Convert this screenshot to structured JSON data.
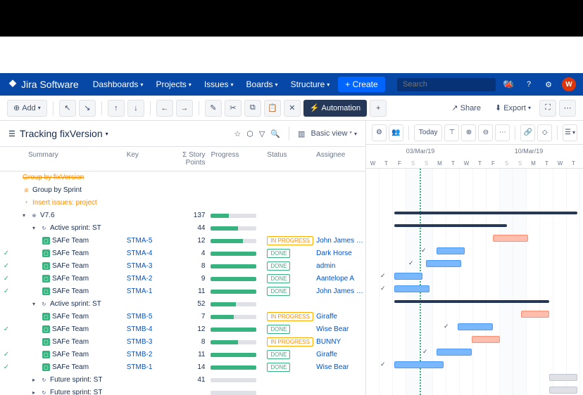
{
  "nav": {
    "product": "Jira Software",
    "items": [
      "Dashboards",
      "Projects",
      "Issues",
      "Boards",
      "Structure"
    ],
    "create": "+ Create",
    "search_placeholder": "Search",
    "avatar_letter": "W"
  },
  "toolbar": {
    "add": "Add",
    "automation": "Automation",
    "share": "Share",
    "export": "Export"
  },
  "structure": {
    "title": "Tracking fixVersion",
    "basic_view": "Basic view"
  },
  "columns": {
    "summary": "Summary",
    "key": "Key",
    "sp": "Σ Story Points",
    "progress": "Progress",
    "status": "Status",
    "assignee": "Assignee"
  },
  "rows": [
    {
      "indent": 1,
      "type": "group",
      "summary": "Group by fixVersion",
      "strike": true,
      "expand": "",
      "check": false
    },
    {
      "indent": 1,
      "type": "group",
      "summary": "Group by Sprint",
      "icon": "⊞",
      "iconColor": "#ff8b00",
      "expand": "",
      "check": false
    },
    {
      "indent": 1,
      "type": "add",
      "summary": "Insert issues: project",
      "icon": "+",
      "iconColor": "#ff8b00",
      "expand": "",
      "check": false
    },
    {
      "indent": 1,
      "type": "version",
      "summary": "V7.6",
      "expand": "v",
      "sp": "137",
      "prog": [
        40,
        60
      ],
      "check": false,
      "icon": "⊕"
    },
    {
      "indent": 2,
      "type": "sprint",
      "summary": "Active sprint: ST",
      "expand": "v",
      "sp": "44",
      "prog": [
        60,
        40
      ],
      "check": false,
      "icon": "↻"
    },
    {
      "indent": 3,
      "type": "story",
      "summary": "SAFe Team",
      "key": "STMA-5",
      "sp": "12",
      "prog": [
        70,
        30
      ],
      "status": "IN PROGRESS",
      "assignee": "John James O'D",
      "check": false
    },
    {
      "indent": 3,
      "type": "story",
      "summary": "SAFe Team",
      "key": "STMA-4",
      "sp": "4",
      "prog": [
        100,
        0
      ],
      "status": "DONE",
      "assignee": "Dark Horse",
      "check": true
    },
    {
      "indent": 3,
      "type": "story",
      "summary": "SAFe Team",
      "key": "STMA-3",
      "sp": "8",
      "prog": [
        100,
        0
      ],
      "status": "DONE",
      "assignee": "admin",
      "check": true
    },
    {
      "indent": 3,
      "type": "story",
      "summary": "SAFe Team",
      "key": "STMA-2",
      "sp": "9",
      "prog": [
        100,
        0
      ],
      "status": "DONE",
      "assignee": "Aantelope A",
      "check": true
    },
    {
      "indent": 3,
      "type": "story",
      "summary": "SAFe Team",
      "key": "STMA-1",
      "sp": "11",
      "prog": [
        100,
        0
      ],
      "status": "DONE",
      "assignee": "John James O'D",
      "check": true
    },
    {
      "indent": 2,
      "type": "sprint",
      "summary": "Active sprint: ST",
      "expand": "v",
      "sp": "52",
      "prog": [
        55,
        45
      ],
      "check": false,
      "icon": "↻"
    },
    {
      "indent": 3,
      "type": "story",
      "summary": "SAFe Team",
      "key": "STMB-5",
      "sp": "7",
      "prog": [
        50,
        50
      ],
      "status": "IN PROGRESS",
      "assignee": "Giraffe",
      "check": false
    },
    {
      "indent": 3,
      "type": "story",
      "summary": "SAFe Team",
      "key": "STMB-4",
      "sp": "12",
      "prog": [
        100,
        0
      ],
      "status": "DONE",
      "assignee": "Wise Bear",
      "check": true
    },
    {
      "indent": 3,
      "type": "story",
      "summary": "SAFe Team",
      "key": "STMB-3",
      "sp": "8",
      "prog": [
        60,
        40
      ],
      "status": "IN PROGRESS",
      "assignee": "BUNNY",
      "check": false
    },
    {
      "indent": 3,
      "type": "story",
      "summary": "SAFe Team",
      "key": "STMB-2",
      "sp": "11",
      "prog": [
        100,
        0
      ],
      "status": "DONE",
      "assignee": "Giraffe",
      "check": true
    },
    {
      "indent": 3,
      "type": "story",
      "summary": "SAFe Team",
      "key": "STMB-1",
      "sp": "14",
      "prog": [
        100,
        0
      ],
      "status": "DONE",
      "assignee": "Wise Bear",
      "check": true
    },
    {
      "indent": 2,
      "type": "sprint",
      "summary": "Future sprint: ST",
      "expand": ">",
      "sp": "41",
      "prog": [
        0,
        100
      ],
      "check": false,
      "icon": "↻"
    },
    {
      "indent": 2,
      "type": "sprint",
      "summary": "Future sprint: ST",
      "expand": ">",
      "prog": [
        0,
        100
      ],
      "check": false,
      "icon": "↻"
    }
  ],
  "gantt": {
    "today_label": "Today",
    "dates": [
      "03/Mar/19",
      "10/Mar/19"
    ],
    "days": [
      "W",
      "T",
      "F",
      "S",
      "S",
      "M",
      "T",
      "W",
      "T",
      "F",
      "S",
      "S",
      "M",
      "T",
      "W",
      "T"
    ],
    "weekend_idx": [
      3,
      4,
      10,
      11
    ]
  }
}
